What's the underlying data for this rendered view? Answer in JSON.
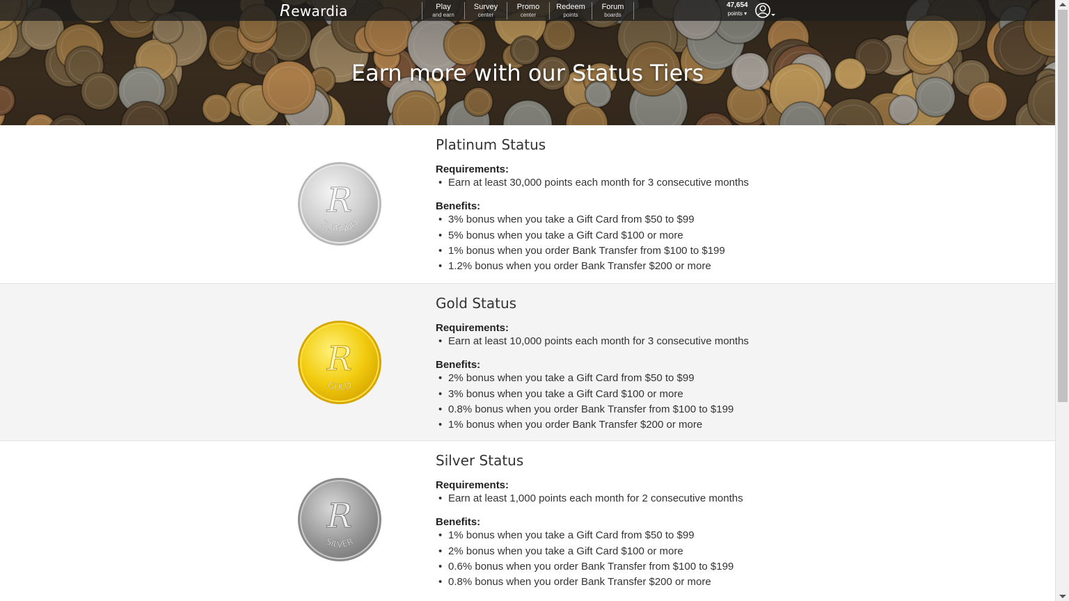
{
  "header": {
    "logo_initial": "R",
    "logo_rest": "ewardia",
    "nav": [
      {
        "title": "Play",
        "sub": "and earn"
      },
      {
        "title": "Survey",
        "sub": "center"
      },
      {
        "title": "Promo",
        "sub": "center"
      },
      {
        "title": "Redeem",
        "sub": "points"
      },
      {
        "title": "Forum",
        "sub": "boards"
      }
    ],
    "points_value": "47,654",
    "points_label": "points ▾"
  },
  "hero": {
    "title": "Earn more with our Status Tiers"
  },
  "tiers": [
    {
      "title": "Platinum Status",
      "medal_text": "PLATINUM",
      "requirements_label": "Requirements:",
      "requirements": [
        "Earn at least 30,000 points each month for 3 consecutive months"
      ],
      "benefits_label": "Benefits:",
      "benefits": [
        "3% bonus when you take a Gift Card from $50 to $99",
        "5% bonus when you take a Gift Card $100 or more",
        "1% bonus when you order Bank Transfer from $100 to $199",
        "1.2% bonus when you order Bank Transfer $200 or more"
      ]
    },
    {
      "title": "Gold Status",
      "medal_text": "GOLD",
      "requirements_label": "Requirements:",
      "requirements": [
        "Earn at least 10,000 points each month for 3 consecutive months"
      ],
      "benefits_label": "Benefits:",
      "benefits": [
        "2% bonus when you take a Gift Card from $50 to $99",
        "3% bonus when you take a Gift Card $100 or more",
        "0.8% bonus when you order Bank Transfer from $100 to $199",
        "1% bonus when you order Bank Transfer $200 or more"
      ]
    },
    {
      "title": "Silver Status",
      "medal_text": "SILVER",
      "requirements_label": "Requirements:",
      "requirements": [
        "Earn at least 1,000 points each month for 2 consecutive months"
      ],
      "benefits_label": "Benefits:",
      "benefits": [
        "1% bonus when you take a Gift Card from $50 to $99",
        "2% bonus when you take a Gift Card $100 or more",
        "0.6% bonus when you order Bank Transfer from $100 to $199",
        "0.8% bonus when you order Bank Transfer $200 or more"
      ]
    }
  ]
}
